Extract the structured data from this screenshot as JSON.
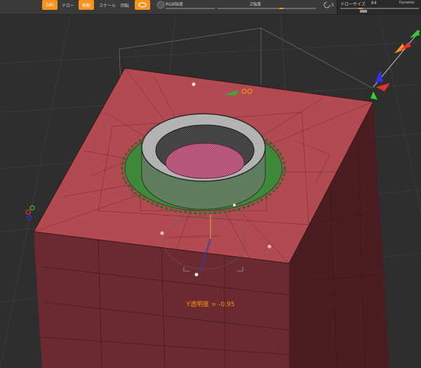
{
  "toolbar": {
    "edit_label": "Edit",
    "draw_label": "ドロー",
    "move_label": "移動",
    "scale_label": "スケール",
    "rotate_label": "回転",
    "rgb_label": "RGB強度",
    "z_label": "Z強度",
    "s_label": "S",
    "draw_size_label": "ドローサイズ",
    "draw_size_value": "64",
    "dynamic_label": "Dynamic"
  },
  "viewport": {
    "status_text": "Y透明度 = -0.95"
  },
  "colors": {
    "accent": "#f7931e",
    "mesh_red": "#b24a52",
    "mesh_green": "#3e8a3a",
    "background": "#2e2e2e"
  }
}
